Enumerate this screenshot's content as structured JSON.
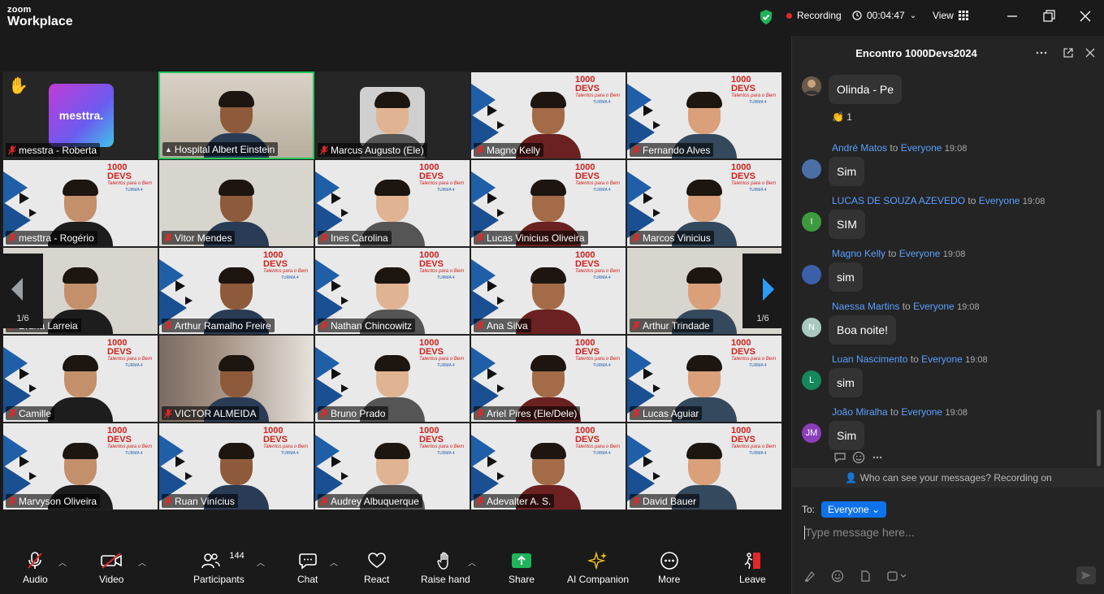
{
  "app": {
    "logo_top": "zoom",
    "logo_bottom": "Workplace"
  },
  "titlebar": {
    "recording_label": "Recording",
    "timer": "00:04:47",
    "view_label": "View"
  },
  "colors": {
    "accent": "#0e72ed",
    "record": "#e02828",
    "active_speaker": "#23c55e",
    "link": "#5aa0ff"
  },
  "gallery": {
    "page_indicator": "1/6",
    "tiles": [
      {
        "name": "messtra - Roberta",
        "muted": true,
        "kind": "logo",
        "logo_text": "mesttra."
      },
      {
        "name": "Hospital Albert Einstein",
        "muted": false,
        "kind": "photo",
        "active": true
      },
      {
        "name": "Marcus Augusto (Ele)",
        "muted": true,
        "kind": "dark"
      },
      {
        "name": "Magno Kelly",
        "muted": true,
        "kind": "brand"
      },
      {
        "name": "Fernando Alves",
        "muted": true,
        "kind": "brand"
      },
      {
        "name": "mesttra - Rogério",
        "muted": true,
        "kind": "brand"
      },
      {
        "name": "Vitor Mendes",
        "muted": true,
        "kind": "plain"
      },
      {
        "name": "Ines Carolina",
        "muted": true,
        "kind": "brand"
      },
      {
        "name": "Lucas Vinicius Oliveira",
        "muted": true,
        "kind": "brand"
      },
      {
        "name": "Marcos Vinicius",
        "muted": true,
        "kind": "brand"
      },
      {
        "name": "Bruna Larreia",
        "muted": true,
        "kind": "plain"
      },
      {
        "name": "Arthur Ramalho Freire",
        "muted": true,
        "kind": "brand"
      },
      {
        "name": "Nathan Chincowitz",
        "muted": true,
        "kind": "brand"
      },
      {
        "name": "Ana Silva",
        "muted": true,
        "kind": "brand"
      },
      {
        "name": "Arthur Trindade",
        "muted": true,
        "kind": "plain"
      },
      {
        "name": "Camille",
        "muted": true,
        "kind": "brand"
      },
      {
        "name": "VICTOR ALMEIDA",
        "muted": true,
        "kind": "blur"
      },
      {
        "name": "Bruno Prado",
        "muted": true,
        "kind": "brand"
      },
      {
        "name": "Ariel Pires (Ele/Dele)",
        "muted": true,
        "kind": "brand"
      },
      {
        "name": "Lucas Aguiar",
        "muted": true,
        "kind": "brand"
      },
      {
        "name": "Marvyson Oliveira",
        "muted": true,
        "kind": "brand"
      },
      {
        "name": "Ruan Vinícius",
        "muted": true,
        "kind": "brand"
      },
      {
        "name": "Audrey Albuquerque",
        "muted": true,
        "kind": "brand"
      },
      {
        "name": "Adevalter A. S.",
        "muted": true,
        "kind": "brand"
      },
      {
        "name": "David Bauer",
        "muted": true,
        "kind": "brand"
      }
    ],
    "brand": {
      "title": "1000 DEVS",
      "tagline": "Talentos para o Bem",
      "turma": "TURMA 4"
    }
  },
  "toolbar": {
    "audio": "Audio",
    "video": "Video",
    "participants": "Participants",
    "participants_count": "144",
    "chat": "Chat",
    "react": "React",
    "raise_hand": "Raise hand",
    "share": "Share",
    "ai_companion": "AI Companion",
    "more": "More",
    "leave": "Leave"
  },
  "chat": {
    "title": "Encontro 1000Devs2024",
    "first_bubble": "Olinda - Pe",
    "reaction": "👏 1",
    "to_word": "to",
    "messages": [
      {
        "name": "André Matos",
        "to": "Everyone",
        "time": "19:08",
        "text": "Sim",
        "avatar": "",
        "avatar_color": "#4a6fa5"
      },
      {
        "name": "LUCAS DE SOUZA AZEVEDO",
        "to": "Everyone",
        "time": "19:08",
        "text": "SIM",
        "avatar": "I",
        "avatar_color": "#3e9a3e"
      },
      {
        "name": "Magno Kelly",
        "to": "Everyone",
        "time": "19:08",
        "text": "sim",
        "avatar": "",
        "avatar_color": "#3b5fa8"
      },
      {
        "name": "Naessa Martins",
        "to": "Everyone",
        "time": "19:08",
        "text": "Boa noite!",
        "avatar": "N",
        "avatar_color": "#a9c9c0"
      },
      {
        "name": "Luan Nascimento",
        "to": "Everyone",
        "time": "19:08",
        "text": "sim",
        "avatar": "L",
        "avatar_color": "#15885e"
      },
      {
        "name": "João Miralha",
        "to": "Everyone",
        "time": "19:08",
        "text": "Sim",
        "avatar": "JM",
        "avatar_color": "#8a3fb8"
      }
    ],
    "notice": "Who can see your messages? Recording on",
    "to_label": "To:",
    "recipient": "Everyone",
    "placeholder": "Type message here..."
  }
}
